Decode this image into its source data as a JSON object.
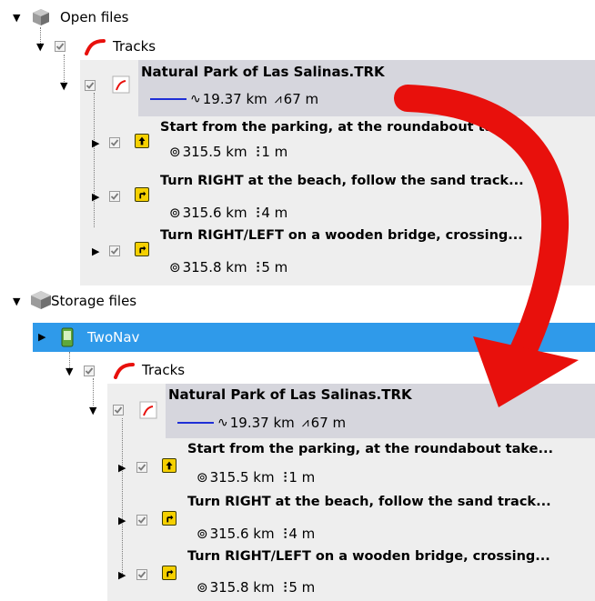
{
  "tree": {
    "open_files": {
      "label": "Open files",
      "tracks_label": "Tracks",
      "track": {
        "name": "Natural Park of Las Salinas.TRK",
        "distance": "19.37 km",
        "elevation": "67 m"
      },
      "waypoints": [
        {
          "text": "Start from the parking, at the roundabout take...",
          "distance": "315.5 km",
          "height": "1 m"
        },
        {
          "text": "Turn RIGHT at the beach, follow the sand track...",
          "distance": "315.6 km",
          "height": "4 m"
        },
        {
          "text": "Turn RIGHT/LEFT on a wooden bridge, crossing...",
          "distance": "315.8 km",
          "height": "5 m"
        }
      ]
    },
    "storage_files": {
      "label": "Storage files",
      "device_label": "TwoNav",
      "tracks_label": "Tracks",
      "track": {
        "name": "Natural Park of Las Salinas.TRK",
        "distance": "19.37 km",
        "elevation": "67 m"
      },
      "waypoints": [
        {
          "text": "Start from the parking, at the roundabout take...",
          "distance": "315.5 km",
          "height": "1 m"
        },
        {
          "text": "Turn RIGHT at the beach, follow the sand track...",
          "distance": "315.6 km",
          "height": "4 m"
        },
        {
          "text": "Turn RIGHT/LEFT on a wooden bridge, crossing...",
          "distance": "315.8 km",
          "height": "5 m"
        }
      ]
    }
  },
  "colors": {
    "selection": "#2f9aea",
    "track_line": "#1f2fd6",
    "arrow": "#e8100c",
    "panel": "#eeeeee",
    "header": "#d6d6dd"
  },
  "icons": {
    "root": "box-icon",
    "tracks": "red-track-icon",
    "device": "gps-device-icon",
    "waypoint_up": "arrow-up-icon",
    "waypoint_turn": "turn-right-icon"
  }
}
